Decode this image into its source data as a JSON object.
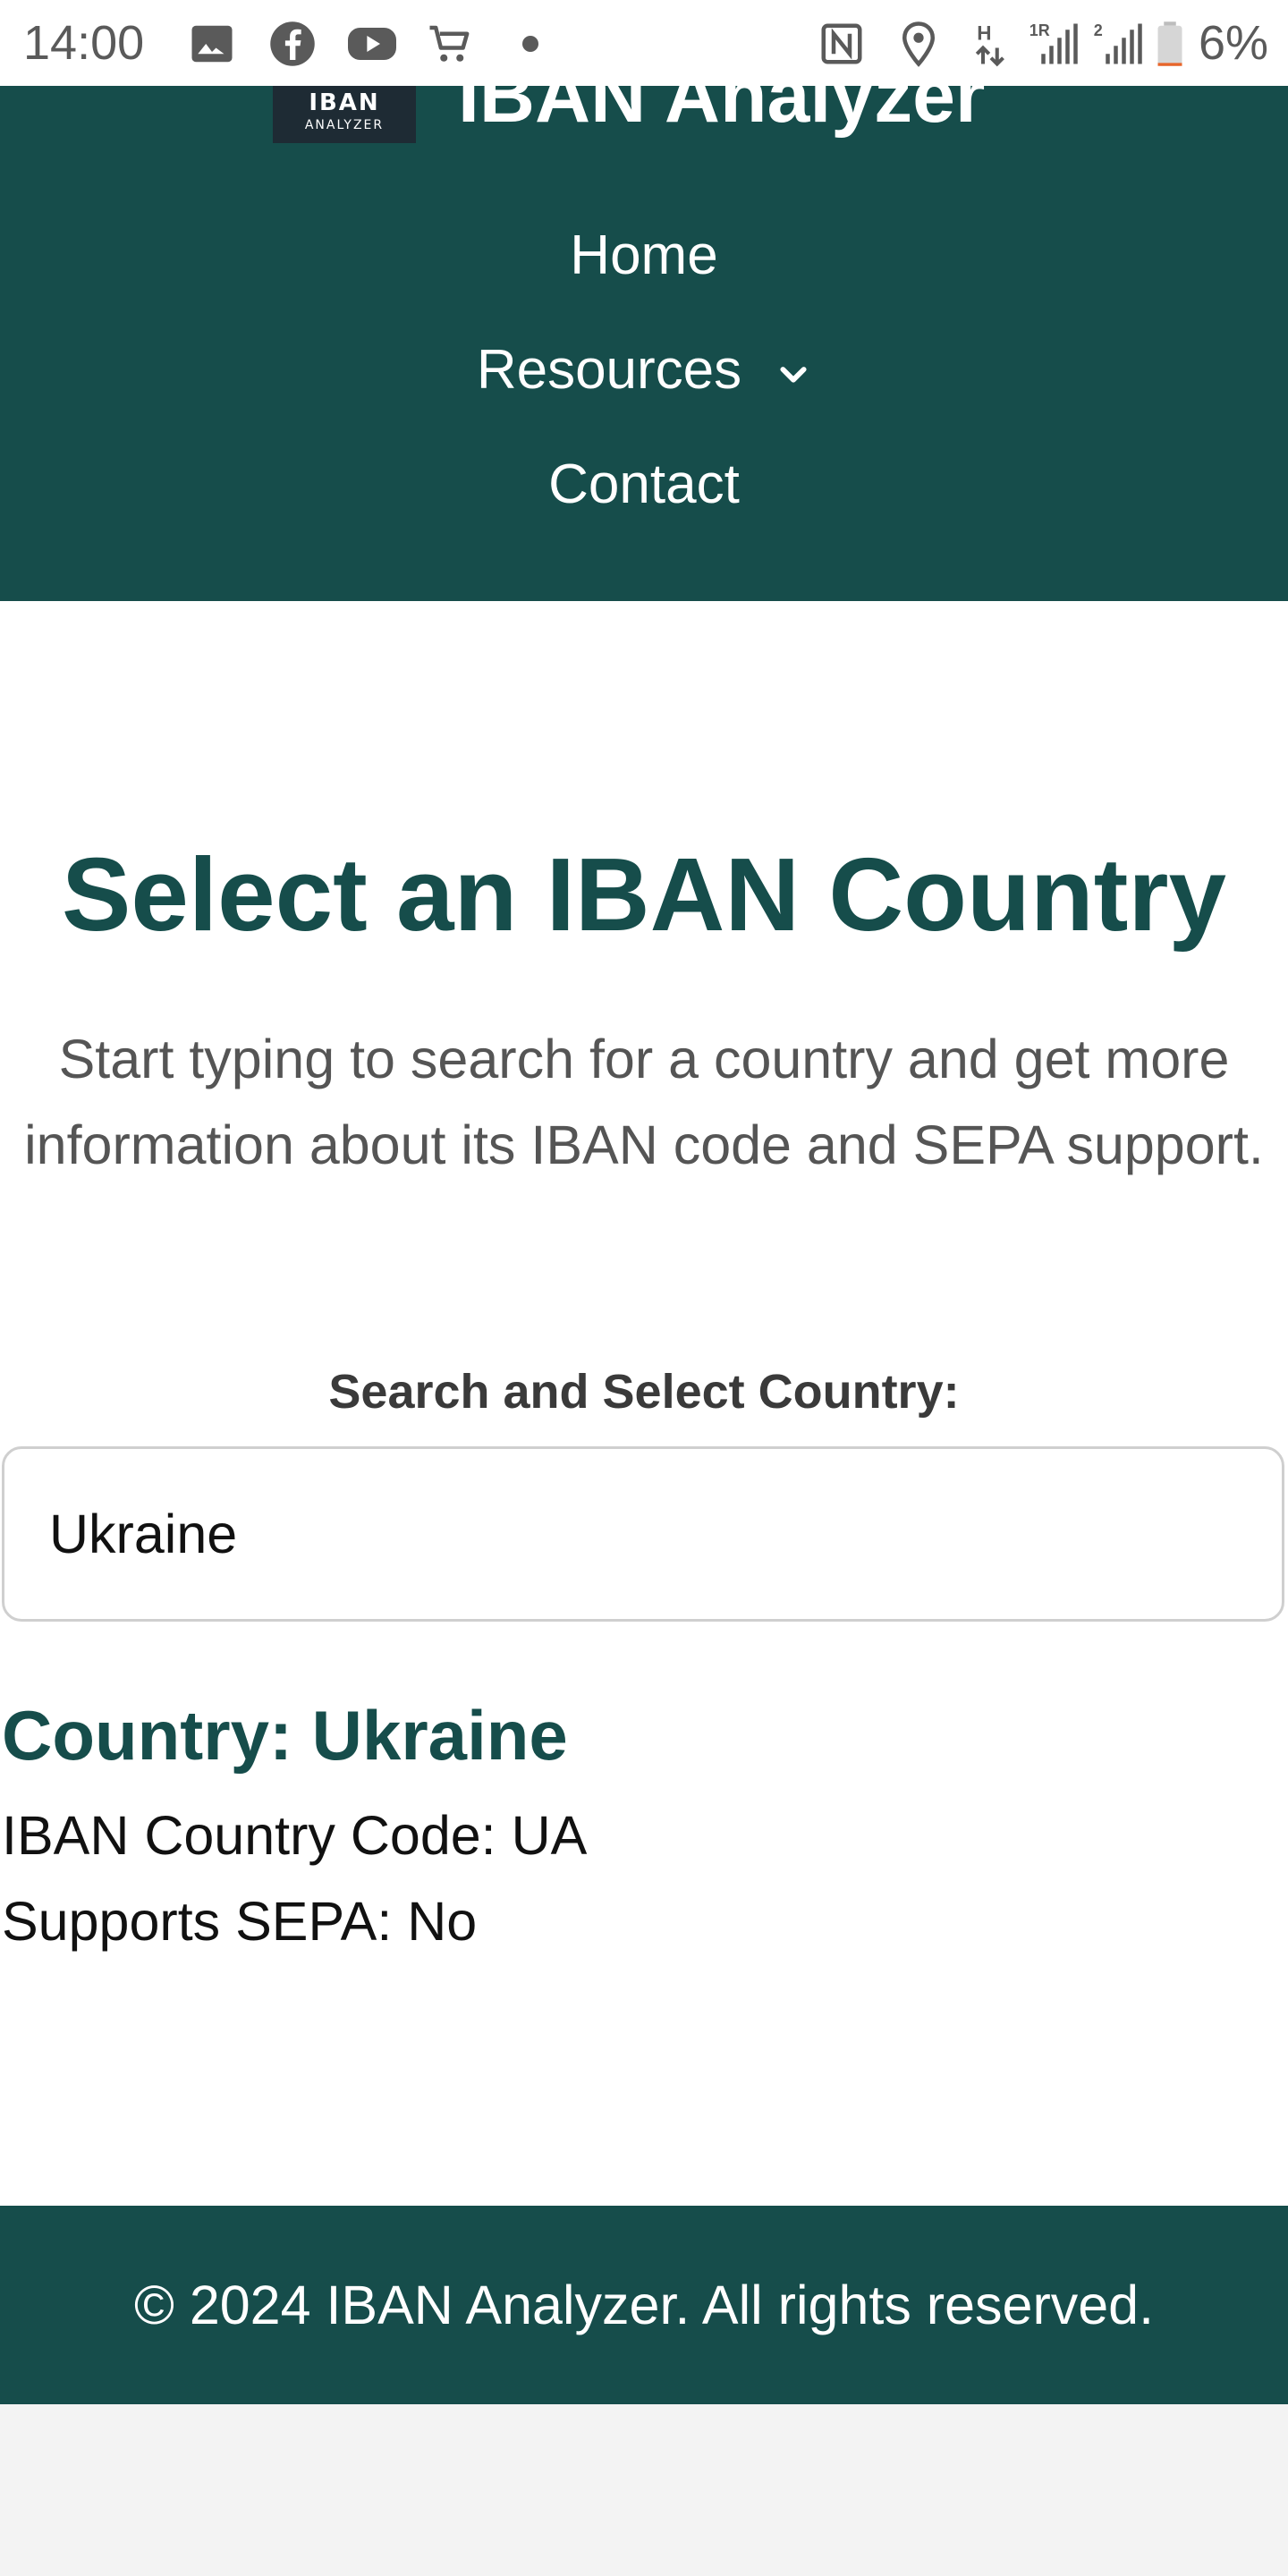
{
  "status_bar": {
    "time": "14:00",
    "battery_text": "6%",
    "left_icons": [
      "image-icon",
      "facebook-icon",
      "youtube-icon",
      "cart-icon",
      "dot-icon"
    ],
    "right_icons": [
      "nfc-icon",
      "location-icon",
      "data-arrows-icon",
      "signal-1-icon",
      "signal-2-icon",
      "battery-icon"
    ],
    "signal_labels": {
      "h": "H",
      "sim1": "1R",
      "sim2": "2"
    },
    "battery_level": 0.06,
    "battery_color": "#e8652a"
  },
  "header": {
    "logo_text": "IBAN",
    "logo_subtext": "ANALYZER",
    "site_title": "IBAN Analyzer",
    "nav": [
      {
        "label": "Home"
      },
      {
        "label": "Resources"
      },
      {
        "label": "Contact"
      }
    ]
  },
  "main": {
    "title": "Select an IBAN Country",
    "intro": "Start typing to search for a country and get more information about its IBAN code and SEPA support.",
    "search": {
      "label": "Search and Select Country:",
      "value": "Ukraine",
      "placeholder": ""
    },
    "result": {
      "title": "Country: Ukraine",
      "iban_code": "IBAN Country Code: UA",
      "sepa": "Supports SEPA: No"
    }
  },
  "footer": {
    "text": "© 2024 IBAN Analyzer. All rights reserved."
  },
  "colors": {
    "brand": "#164d4b",
    "page_background": "#f3f3f3",
    "content_background": "#ffffff",
    "logo_background": "#1e2b34",
    "text_muted": "#555555",
    "input_border": "#cfcfcf"
  }
}
